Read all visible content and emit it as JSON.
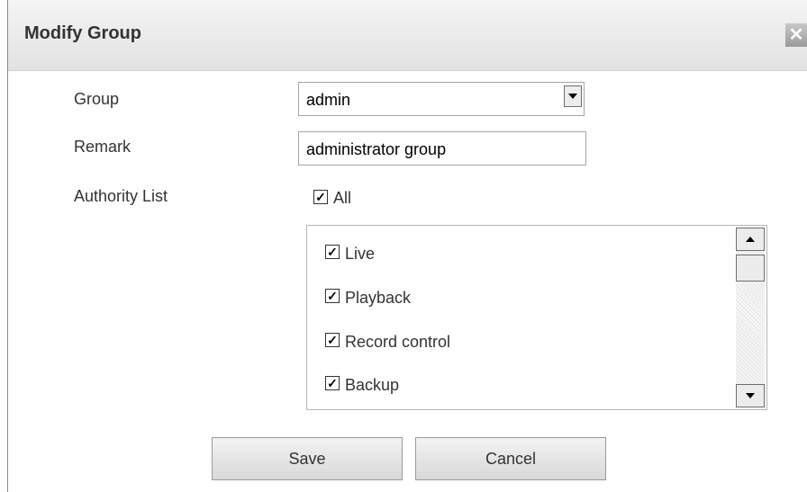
{
  "dialog": {
    "title": "Modify Group",
    "close_glyph": "✕"
  },
  "form": {
    "group_label": "Group",
    "group_value": "admin",
    "remark_label": "Remark",
    "remark_value": "administrator group",
    "authority_label": "Authority List",
    "all_label": "All",
    "all_checked": true,
    "authorities": [
      {
        "label": "Live",
        "checked": true
      },
      {
        "label": "Playback",
        "checked": true
      },
      {
        "label": "Record control",
        "checked": true
      },
      {
        "label": "Backup",
        "checked": true
      }
    ]
  },
  "buttons": {
    "save": "Save",
    "cancel": "Cancel"
  },
  "icons": {
    "close": "close-icon",
    "dropdown": "chevron-down-icon",
    "scroll_up": "arrow-up-icon",
    "scroll_down": "arrow-down-icon",
    "check": "checkmark-icon"
  },
  "colors": {
    "titlebar": "#e8e8e8",
    "text": "#333333",
    "border": "#a5a5a5"
  }
}
